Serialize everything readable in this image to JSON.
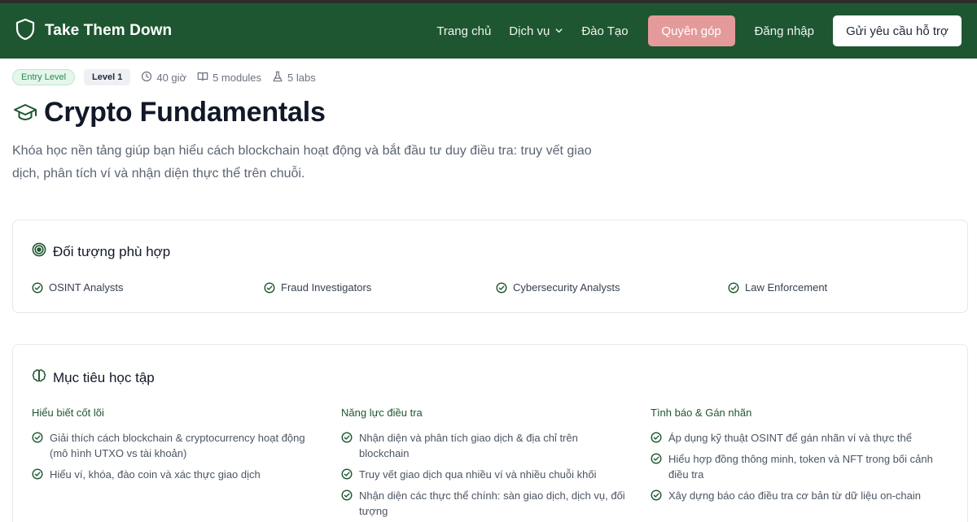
{
  "nav": {
    "brand": "Take Them Down",
    "links": [
      "Trang chủ",
      "Dịch vụ",
      "Đào Tạo"
    ],
    "donate": "Quyên góp",
    "login": "Đăng nhập",
    "support": "Gửi yêu cầu hỗ trợ",
    "colors": {
      "bar": "#1e5631",
      "donate": "#e59a9a"
    }
  },
  "meta": {
    "badge_level": "Entry Level",
    "level": "Level 1",
    "duration": "40 giờ",
    "modules": "5 modules",
    "labs": "5 labs"
  },
  "course": {
    "title": "Crypto Fundamentals",
    "description": "Khóa học nền tảng giúp bạn hiểu cách blockchain hoạt động và bắt đầu tư duy điều tra: truy vết giao dịch, phân tích ví và nhận diện thực thể trên chuỗi."
  },
  "audience": {
    "title": "Đối tượng phù hợp",
    "items": [
      "OSINT Analysts",
      "Fraud Investigators",
      "Cybersecurity Analysts",
      "Law Enforcement"
    ]
  },
  "objectives": {
    "title": "Mục tiêu học tập",
    "columns": [
      {
        "heading": "Hiểu biết cốt lõi",
        "items": [
          "Giải thích cách blockchain & cryptocurrency hoạt động (mô hình UTXO vs tài khoản)",
          "Hiểu ví, khóa, đào coin và xác thực giao dịch"
        ]
      },
      {
        "heading": "Năng lực điều tra",
        "items": [
          "Nhận diện và phân tích giao dịch & địa chỉ trên blockchain",
          "Truy vết giao dịch qua nhiều ví và nhiều chuỗi khối",
          "Nhận diện các thực thể chính: sàn giao dịch, dịch vụ, đối tượng"
        ]
      },
      {
        "heading": "Tình báo & Gán nhãn",
        "items": [
          "Áp dụng kỹ thuật OSINT để gán nhãn ví và thực thể",
          "Hiểu hợp đồng thông minh, token và NFT trong bối cảnh điều tra",
          "Xây dựng báo cáo điều tra cơ bản từ dữ liệu on-chain"
        ]
      }
    ]
  }
}
